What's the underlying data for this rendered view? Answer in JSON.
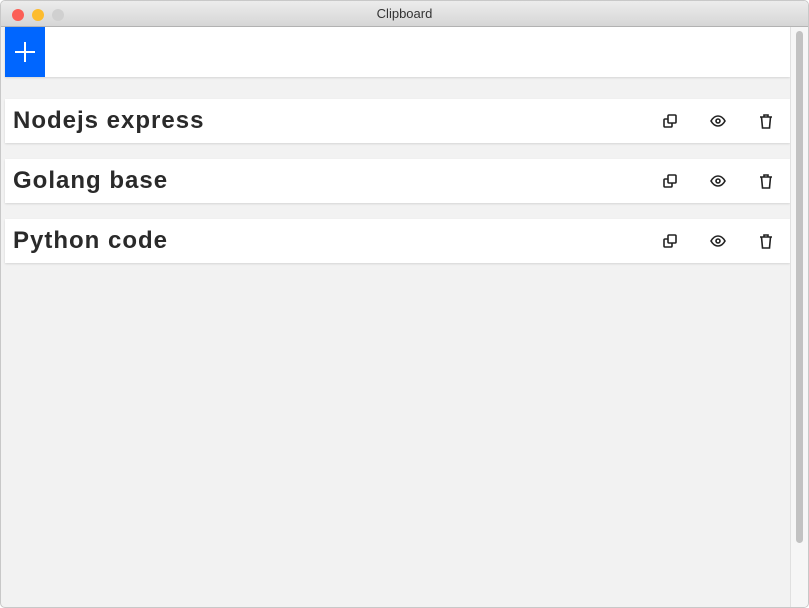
{
  "window": {
    "title": "Clipboard"
  },
  "toolbar": {
    "add_icon": "plus-icon",
    "accent": "#0066ff"
  },
  "items": [
    {
      "title": "Nodejs express"
    },
    {
      "title": "Golang base"
    },
    {
      "title": "Python code"
    }
  ],
  "item_actions": [
    "copy-icon",
    "eye-icon",
    "trash-icon"
  ]
}
